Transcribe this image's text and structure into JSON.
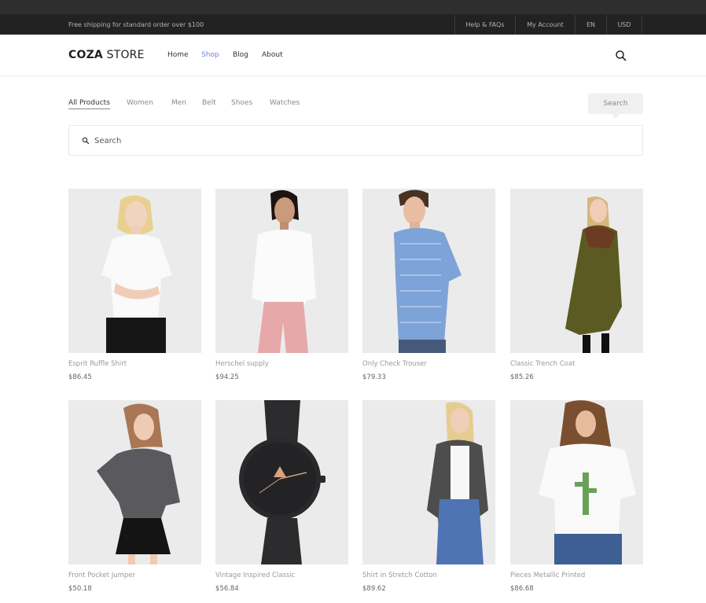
{
  "topbar": {
    "shipping_text": "Free shipping for standard order over $100",
    "links": [
      "Help & FAQs",
      "My Account",
      "EN",
      "USD"
    ]
  },
  "header": {
    "logo_bold": "COZA",
    "logo_rest": " STORE",
    "nav": [
      "Home",
      "Shop",
      "Blog",
      "About"
    ],
    "active_nav": "Shop"
  },
  "filters": {
    "items": [
      "All Products",
      "Women",
      "Men",
      "Belt",
      "Shoes",
      "Watches"
    ],
    "active": "All Products",
    "search_toggle_label": "Search"
  },
  "search": {
    "placeholder": "Search"
  },
  "products": [
    {
      "name": "Esprit Ruffle Shirt",
      "price": "$86.45"
    },
    {
      "name": "Herschel supply",
      "price": "$94.25"
    },
    {
      "name": "Only Check Trouser",
      "price": "$79.33"
    },
    {
      "name": "Classic Trench Coat",
      "price": "$85.26"
    },
    {
      "name": "Front Pocket Jumper",
      "price": "$50.18"
    },
    {
      "name": "Vintage Inspired Classic",
      "price": "$56.84"
    },
    {
      "name": "Shirt in Stretch Cotton",
      "price": "$89.62"
    },
    {
      "name": "Pieces Metallic Printed",
      "price": "$86.68"
    }
  ],
  "colors": {
    "accent": "#717fe0",
    "topbar": "#222222"
  }
}
